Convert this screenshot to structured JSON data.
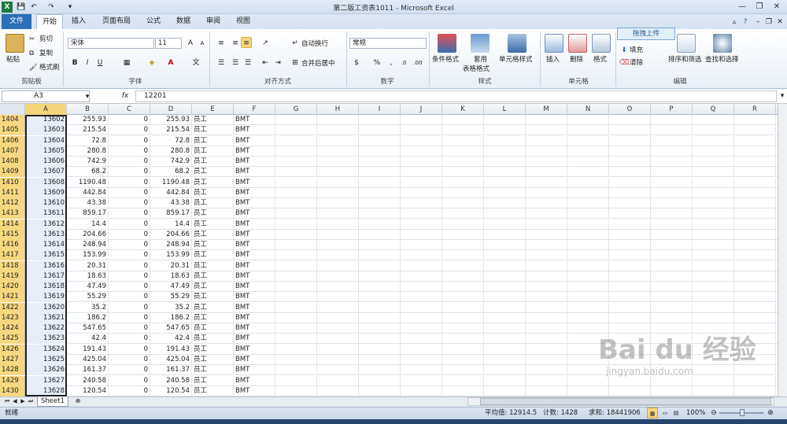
{
  "window": {
    "title": "第二版工资表1011 - Microsoft Excel",
    "app_icon": "X"
  },
  "ribbon_tabs": {
    "file": "文件",
    "tabs": [
      "开始",
      "插入",
      "页面布局",
      "公式",
      "数据",
      "审阅",
      "视图"
    ],
    "active": "开始"
  },
  "clipboard": {
    "paste": "粘贴",
    "cut": "剪切",
    "copy": "复制",
    "format_painter": "格式刷",
    "group": "剪贴板"
  },
  "font": {
    "name": "宋体",
    "size": "11",
    "bold": "B",
    "italic": "I",
    "underline": "U",
    "group": "字体"
  },
  "alignment": {
    "wrap": "自动换行",
    "merge": "合并后居中",
    "group": "对齐方式"
  },
  "number": {
    "format": "常规",
    "group": "数字"
  },
  "styles": {
    "conditional": "条件格式",
    "table": "套用",
    "table2": "表格格式",
    "cell_styles": "单元格样式",
    "group": "样式"
  },
  "cells": {
    "insert": "插入",
    "delete": "删除",
    "format": "格式",
    "group": "单元格"
  },
  "editing": {
    "upload": "拖拽上传",
    "fill": "填充",
    "clear": "清除",
    "sort": "排序和筛选",
    "find": "查找和选择",
    "group": "编辑"
  },
  "formula_bar": {
    "name_box": "A3",
    "fx": "fx",
    "value": "12201"
  },
  "columns": [
    "A",
    "B",
    "C",
    "D",
    "E",
    "F",
    "G",
    "H",
    "I",
    "J",
    "K",
    "L",
    "M",
    "N",
    "O",
    "P",
    "Q",
    "R"
  ],
  "rows": [
    {
      "r": "1404",
      "a": "13602",
      "b": "255.93",
      "c": "0",
      "d": "255.93",
      "e": "员工",
      "f": "BMT"
    },
    {
      "r": "1405",
      "a": "13603",
      "b": "215.54",
      "c": "0",
      "d": "215.54",
      "e": "员工",
      "f": "BMT"
    },
    {
      "r": "1406",
      "a": "13604",
      "b": "72.8",
      "c": "0",
      "d": "72.8",
      "e": "员工",
      "f": "BMT"
    },
    {
      "r": "1407",
      "a": "13605",
      "b": "280.8",
      "c": "0",
      "d": "280.8",
      "e": "员工",
      "f": "BMT"
    },
    {
      "r": "1408",
      "a": "13606",
      "b": "742.9",
      "c": "0",
      "d": "742.9",
      "e": "员工",
      "f": "BMT"
    },
    {
      "r": "1409",
      "a": "13607",
      "b": "68.2",
      "c": "0",
      "d": "68.2",
      "e": "员工",
      "f": "BMT"
    },
    {
      "r": "1410",
      "a": "13608",
      "b": "1190.48",
      "c": "0",
      "d": "1190.48",
      "e": "员工",
      "f": "BMT"
    },
    {
      "r": "1411",
      "a": "13609",
      "b": "442.84",
      "c": "0",
      "d": "442.84",
      "e": "员工",
      "f": "BMT"
    },
    {
      "r": "1412",
      "a": "13610",
      "b": "43.38",
      "c": "0",
      "d": "43.38",
      "e": "员工",
      "f": "BMT"
    },
    {
      "r": "1413",
      "a": "13611",
      "b": "859.17",
      "c": "0",
      "d": "859.17",
      "e": "员工",
      "f": "BMT"
    },
    {
      "r": "1414",
      "a": "13612",
      "b": "14.4",
      "c": "0",
      "d": "14.4",
      "e": "员工",
      "f": "BMT"
    },
    {
      "r": "1415",
      "a": "13613",
      "b": "204.66",
      "c": "0",
      "d": "204.66",
      "e": "员工",
      "f": "BMT"
    },
    {
      "r": "1416",
      "a": "13614",
      "b": "248.94",
      "c": "0",
      "d": "248.94",
      "e": "员工",
      "f": "BMT"
    },
    {
      "r": "1417",
      "a": "13615",
      "b": "153.99",
      "c": "0",
      "d": "153.99",
      "e": "员工",
      "f": "BMT"
    },
    {
      "r": "1418",
      "a": "13616",
      "b": "20.31",
      "c": "0",
      "d": "20.31",
      "e": "员工",
      "f": "BMT"
    },
    {
      "r": "1419",
      "a": "13617",
      "b": "18.63",
      "c": "0",
      "d": "18.63",
      "e": "员工",
      "f": "BMT"
    },
    {
      "r": "1420",
      "a": "13618",
      "b": "47.49",
      "c": "0",
      "d": "47.49",
      "e": "员工",
      "f": "BMT"
    },
    {
      "r": "1421",
      "a": "13619",
      "b": "55.29",
      "c": "0",
      "d": "55.29",
      "e": "员工",
      "f": "BMT"
    },
    {
      "r": "1422",
      "a": "13620",
      "b": "35.2",
      "c": "0",
      "d": "35.2",
      "e": "员工",
      "f": "BMT"
    },
    {
      "r": "1423",
      "a": "13621",
      "b": "186.2",
      "c": "0",
      "d": "186.2",
      "e": "员工",
      "f": "BMT"
    },
    {
      "r": "1424",
      "a": "13622",
      "b": "547.65",
      "c": "0",
      "d": "547.65",
      "e": "员工",
      "f": "BMT"
    },
    {
      "r": "1425",
      "a": "13623",
      "b": "42.4",
      "c": "0",
      "d": "42.4",
      "e": "员工",
      "f": "BMT"
    },
    {
      "r": "1426",
      "a": "13624",
      "b": "191.43",
      "c": "0",
      "d": "191.43",
      "e": "员工",
      "f": "BMT"
    },
    {
      "r": "1427",
      "a": "13625",
      "b": "425.04",
      "c": "0",
      "d": "425.04",
      "e": "员工",
      "f": "BMT"
    },
    {
      "r": "1428",
      "a": "13626",
      "b": "161.37",
      "c": "0",
      "d": "161.37",
      "e": "员工",
      "f": "BMT"
    },
    {
      "r": "1429",
      "a": "13627",
      "b": "240.58",
      "c": "0",
      "d": "240.58",
      "e": "员工",
      "f": "BMT"
    },
    {
      "r": "1430",
      "a": "13628",
      "b": "120.54",
      "c": "0",
      "d": "120.54",
      "e": "员工",
      "f": "BMT"
    }
  ],
  "sheet": {
    "tab": "Sheet1"
  },
  "status": {
    "ready": "就绪",
    "average": "平均值: 12914.5",
    "count": "计数: 1428",
    "sum": "求和: 18441906",
    "zoom": "100%"
  },
  "watermark": {
    "text": "Bai du 经验",
    "url": "jingyan.baidu.com"
  },
  "colors": {
    "accent": "#2a6fb7",
    "selected_header": "#f5d57c",
    "excel_green": "#1d7a3a"
  }
}
